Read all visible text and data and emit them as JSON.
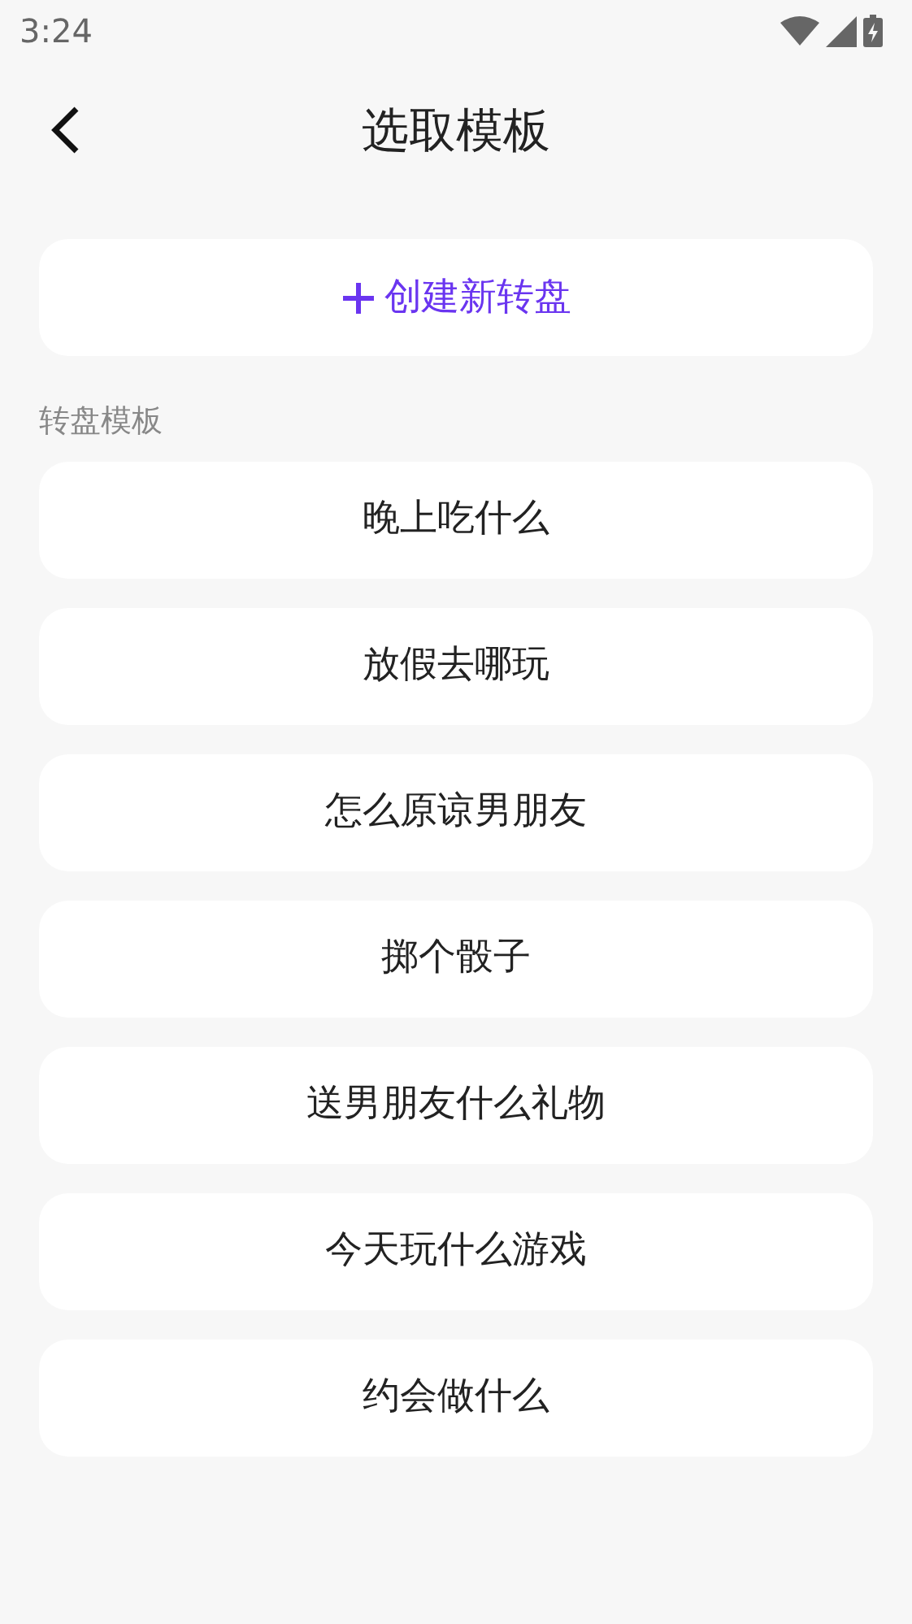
{
  "status_bar": {
    "time": "3:24"
  },
  "header": {
    "title": "选取模板"
  },
  "create_button": {
    "label": "创建新转盘"
  },
  "section": {
    "title": "转盘模板"
  },
  "templates": [
    {
      "label": "晚上吃什么"
    },
    {
      "label": "放假去哪玩"
    },
    {
      "label": "怎么原谅男朋友"
    },
    {
      "label": "掷个骰子"
    },
    {
      "label": "送男朋友什么礼物"
    },
    {
      "label": "今天玩什么游戏"
    },
    {
      "label": "约会做什么"
    }
  ]
}
